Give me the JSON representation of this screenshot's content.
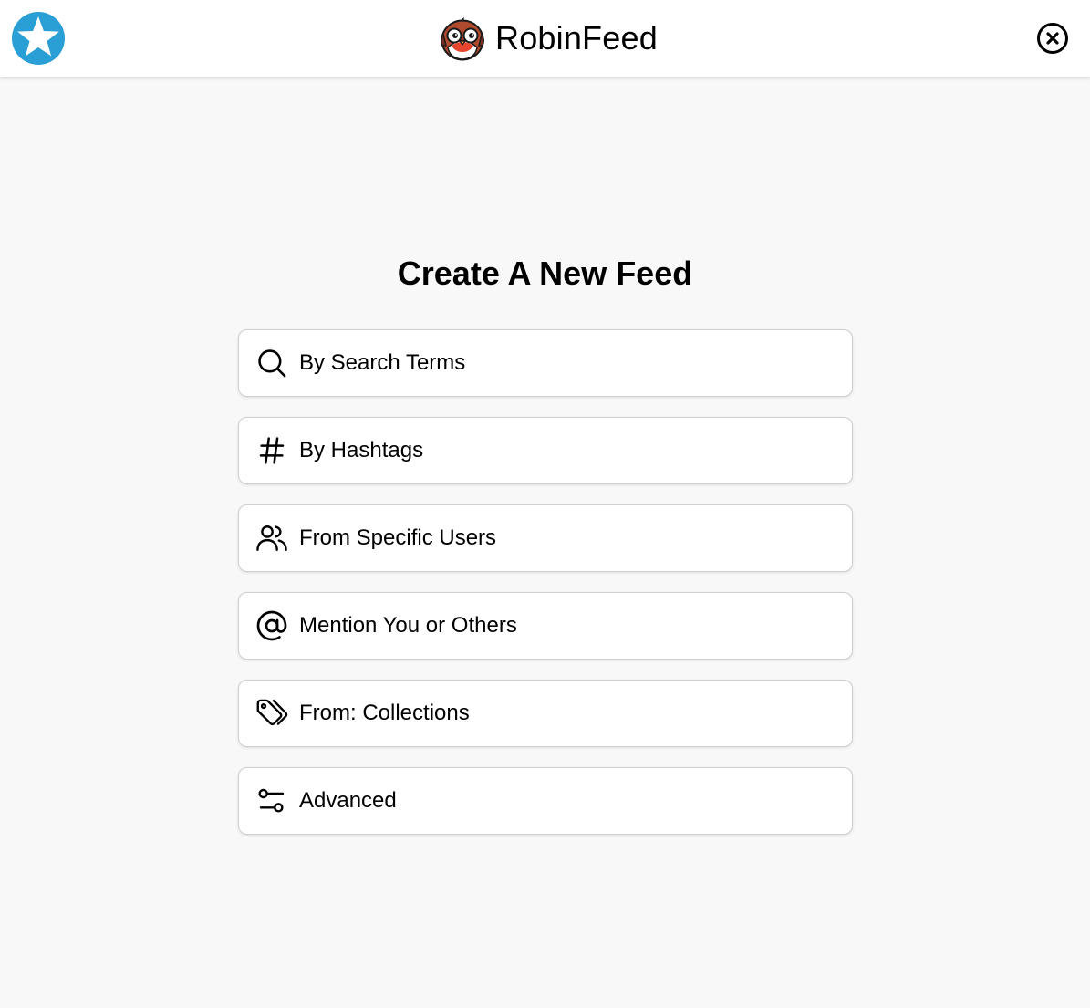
{
  "header": {
    "app_name": "RobinFeed",
    "left_icon": "star-icon",
    "right_icon": "close-circle-icon",
    "accent_color": "#2a9fd6"
  },
  "main": {
    "title": "Create A New Feed",
    "options": [
      {
        "label": "By Search Terms",
        "icon": "search-icon"
      },
      {
        "label": "By Hashtags",
        "icon": "hashtag-icon"
      },
      {
        "label": "From Specific Users",
        "icon": "users-icon"
      },
      {
        "label": "Mention You or Others",
        "icon": "at-sign-icon"
      },
      {
        "label": "From: Collections",
        "icon": "tags-icon"
      },
      {
        "label": "Advanced",
        "icon": "adjustments-icon"
      }
    ]
  }
}
